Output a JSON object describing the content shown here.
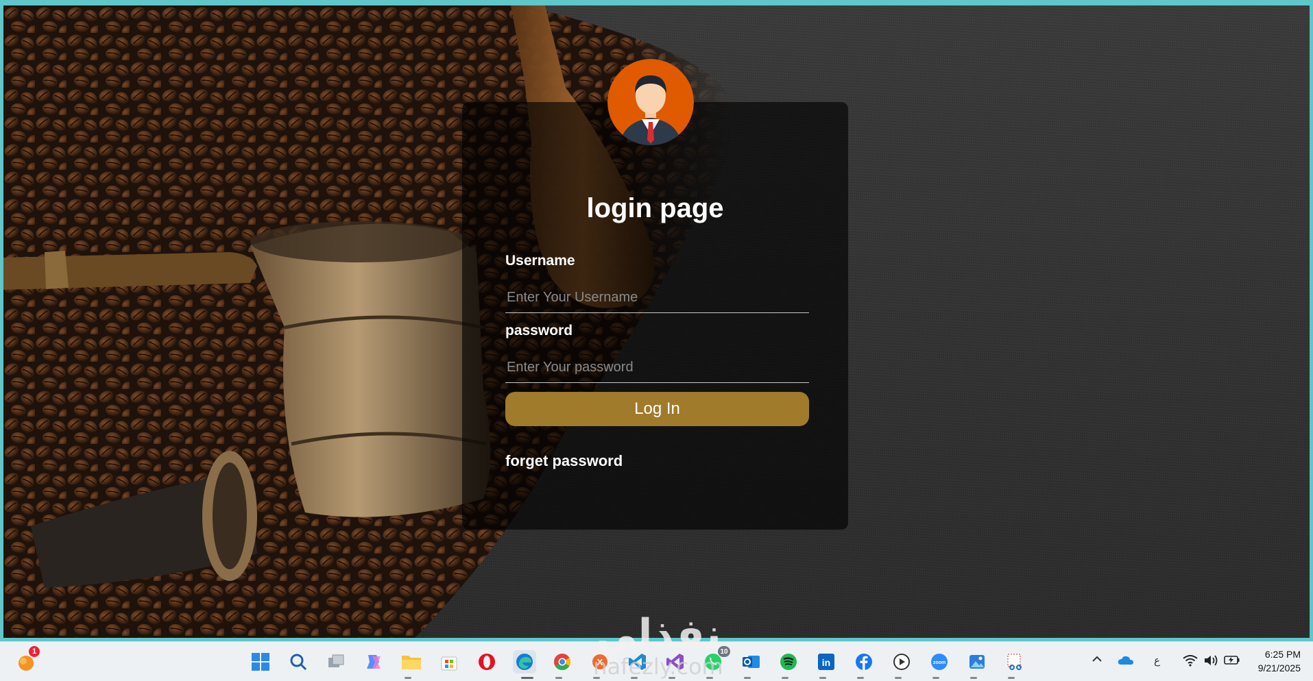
{
  "login": {
    "title": "login page",
    "username_label": "Username",
    "username_placeholder": "Enter Your Username",
    "password_label": "password",
    "password_placeholder": "Enter Your password",
    "login_button": "Log In",
    "forget_link": "forget password"
  },
  "colors": {
    "button": "#a07b2b",
    "avatar_bg": "#e05a00",
    "taskbar": "#eef1f4",
    "frame": "#5fc6c9"
  },
  "taskbar": {
    "notification_badge": "1",
    "whatsapp_badge": "10",
    "icons": [
      "windows-start-icon",
      "search-icon",
      "task-view-icon",
      "copilot-icon",
      "file-explorer-icon",
      "store-icon",
      "opera-icon",
      "edge-icon",
      "chrome-icon",
      "app-icon",
      "vscode-icon",
      "visual-studio-icon",
      "whatsapp-icon",
      "outlook-icon",
      "spotify-icon",
      "linkedin-icon",
      "facebook-icon",
      "media-player-icon",
      "zoom-icon",
      "photos-icon",
      "snipping-tool-icon"
    ],
    "tray": {
      "language": "ع",
      "time": "6:25 PM",
      "date": "9/21/2025"
    }
  },
  "watermark": {
    "arabic": "نفذلي",
    "latin": "nafezly.com"
  }
}
